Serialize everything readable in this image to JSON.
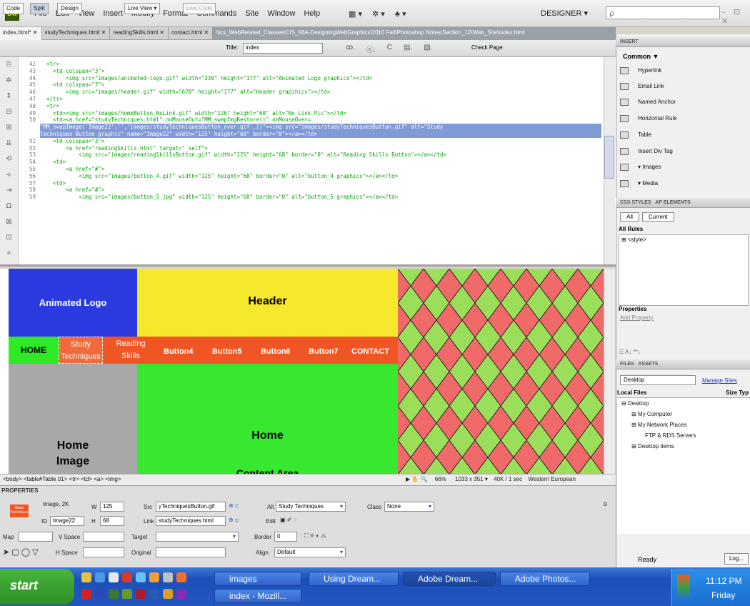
{
  "app": {
    "logo_text": "Dw",
    "workspace": "DESIGNER ▾",
    "search_placeholder": "ρ",
    "window_controls": "– ⊡ ✕"
  },
  "menu": [
    "File",
    "Edit",
    "View",
    "Insert",
    "Modify",
    "Format",
    "Commands",
    "Site",
    "Window",
    "Help"
  ],
  "menu_icons": [
    "▦ ▾",
    "✲ ▾",
    "♣ ▾"
  ],
  "tabs": [
    {
      "label": "index.html* ✕"
    },
    {
      "label": "studyTechniques.html ✕"
    },
    {
      "label": "readingSkills.html ✕"
    },
    {
      "label": "contact.html ✕"
    }
  ],
  "tab_path": "hics_WebRelated_Classes\\CIS_56A-DesigningWebGraphics\\2010 Fall\\Photoshop Notes\\Section_12\\Web_Site\\index.html",
  "doc_toolbar": {
    "code": "Code",
    "split": "Split",
    "design": "Design",
    "live_view": "Live View ▾",
    "live_code": "Live Code",
    "title_label": "Title:",
    "title_value": "index",
    "icons": [
      "ꝏ.",
      "ⓒ.",
      "C",
      "▤.",
      "▧."
    ],
    "check_page": "Check Page"
  },
  "code": {
    "line_numbers": [
      "42",
      "43",
      "44",
      "45",
      "46",
      "47",
      "48",
      "49",
      "50",
      "",
      "",
      "51",
      "52",
      "53",
      "54",
      "55",
      "56",
      "57",
      "58",
      "59"
    ],
    "lines": [
      "  <tr>",
      "    <td colspan=\"3\">",
      "        <img src=\"images/animated-logo.gif\" width=\"330\" height=\"177\" alt=\"Animated Logo graphics\"></td>",
      "    <td colspan=\"7\">",
      "        <img src=\"images/header.gif\" width=\"670\" height=\"177\" alt=\"Header grapihics\"></td>",
      "  </tr>",
      "  <tr>",
      "    <td><img src=\"images/homeButton_NoLink.gif\" width=\"126\" height=\"68\" alt=\"No Link Pic\"></td>",
      "    <td><a href=\"studyTechniques.html\" onMouseOut=\"MM_swapImgRestore()\" onMouseOver=",
      "\"MM_swapImage('Image22','','images/studyTechniquesButton_over.gif',1)\"><img src=\"images/studyTechniquesButton.gif\" alt=\"Study",
      "Techniques Button graphic\" name=\"Image22\" width=\"125\" height=\"68\" border=\"0\"></a></td>",
      "    <td colspan=\"3\">",
      "        <a href=\"readingSkills.html\" target=\"_self\">",
      "            <img src=\"images/readingSkillsButton.gif\" width=\"125\" height=\"68\" border=\"0\" alt=\"Reading Skills Button\"></a></td>",
      "    <td>",
      "        <a href=\"#\">",
      "            <img src=\"images/button_4.gif\" width=\"125\" height=\"68\" border=\"0\" alt=\"button_4 graphics\"></a></td>",
      "    <td>",
      "        <a href=\"#\">",
      "            <img src=\"images/button_5.jpg\" width=\"125\" height=\"68\" border=\"0\" alt=\"button_5 graphics\"></a></td>"
    ],
    "side_icons": [
      "⎘",
      "✲",
      "⇕",
      "⊟",
      "⊞",
      "⇊",
      "⟲",
      "⟡",
      "⇥",
      "Ω",
      "⊠",
      "⊡",
      "⌗",
      "⊞",
      "⇡"
    ]
  },
  "design": {
    "logo": "Animated Logo",
    "header": "Header",
    "nav": {
      "home": "HOME",
      "study": "Study Techniques",
      "reading": "Reading Skills",
      "b4": "Button4",
      "b5": "Button5",
      "b6": "Button6",
      "b7": "Button7",
      "contact": "CONTACT"
    },
    "home_image": "Home Image",
    "content": "Home",
    "content2": "Content Area",
    "colors": {
      "logo": "#2b3bdf",
      "header": "#f6e82c",
      "nav": "#f05524",
      "home": "#2fe826",
      "content": "#38e830",
      "home_img": "#a8a8a8",
      "diamond_red": "#f06a6a",
      "diamond_green": "#9ade5a"
    }
  },
  "status": {
    "tag_path": "<body> <table#Table 01> <tr> <td> <a> <img>",
    "zoom": "66%",
    "size": "1033 x 351 ▾",
    "download": "40K / 1 sec",
    "encoding": "Western European"
  },
  "properties": {
    "title": "PROPERTIES",
    "thumb_text": "Study Techniques",
    "image_label": "Image, 2K",
    "w_label": "W",
    "w": "125",
    "h_label": "H",
    "h": "68",
    "id_label": "ID",
    "id": "Image22",
    "src_label": "Src",
    "src": "yTechniquesButton.gif",
    "link_label": "Link",
    "link": "studyTechniques.html",
    "alt_label": "Alt",
    "alt": "Study Techniques",
    "edit_label": "Edit",
    "class_label": "Class",
    "class": "None",
    "map_label": "Map",
    "vspace_label": "V Space",
    "hspace_label": "H Space",
    "target_label": "Target",
    "original_label": "Original",
    "border_label": "Border",
    "border": "0",
    "align_label": "Align",
    "align": "Default"
  },
  "insert_panel": {
    "tab": "INSERT",
    "category": "Common ▼",
    "items": [
      "Hyperlink",
      "Email Link",
      "Named Anchor",
      "Horizontal Rule",
      "Table",
      "Insert Div Tag",
      "▾ Images",
      "▾ Media"
    ]
  },
  "css_panel": {
    "tab1": "CSS STYLES",
    "tab2": "AP ELEMENTS",
    "all": "All",
    "current": "Current",
    "all_rules": "All Rules",
    "style": "⊞ <style>",
    "properties": "Properties",
    "add_property": "Add Property",
    "toolbar": "☷ A↓ **↓"
  },
  "files_panel": {
    "tab1": "FILES",
    "tab2": "ASSETS",
    "location": "Desktop",
    "manage": "Manage Sites",
    "local_files": "Local Files",
    "size_col": "Size Typ",
    "tree": [
      "⊟ Desktop",
      "⊞ My Computer",
      "⊞ My Network Places",
      "FTP & RDS Servers",
      "⊞ Desktop items"
    ],
    "ready": "Ready",
    "log": "Log..."
  },
  "taskbar": {
    "start": "start",
    "tasks": [
      {
        "label": "images"
      },
      {
        "label": "Using Dream..."
      },
      {
        "label": "Adobe Dream..."
      },
      {
        "label": "Adobe Photos..."
      },
      {
        "label": "index - Mozill..."
      }
    ],
    "time": "11:12 PM",
    "day": "Friday"
  }
}
